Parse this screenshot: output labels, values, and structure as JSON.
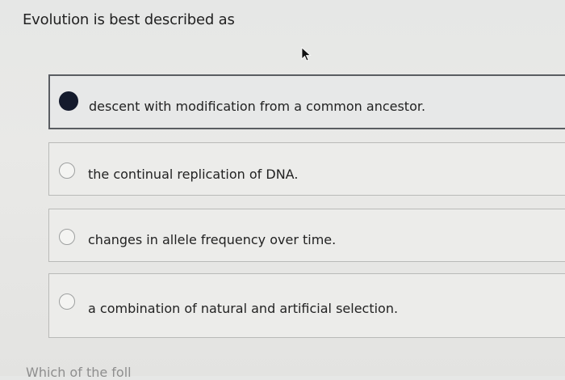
{
  "question": {
    "text": "Evolution is best described as"
  },
  "options": [
    {
      "label": "descent with modification from a common ancestor.",
      "selected": true
    },
    {
      "label": "the continual replication of DNA.",
      "selected": false
    },
    {
      "label": "changes in allele frequency over time.",
      "selected": false
    },
    {
      "label": "a combination of natural and artificial selection.",
      "selected": false
    }
  ],
  "next_question": {
    "partial_text": "Which of the foll"
  },
  "icons": {
    "cursor": "mouse-pointer-icon"
  },
  "colors": {
    "selected_radio": "#141a2c",
    "selected_border": "#5a5d62",
    "option_border": "#b9bab8"
  }
}
